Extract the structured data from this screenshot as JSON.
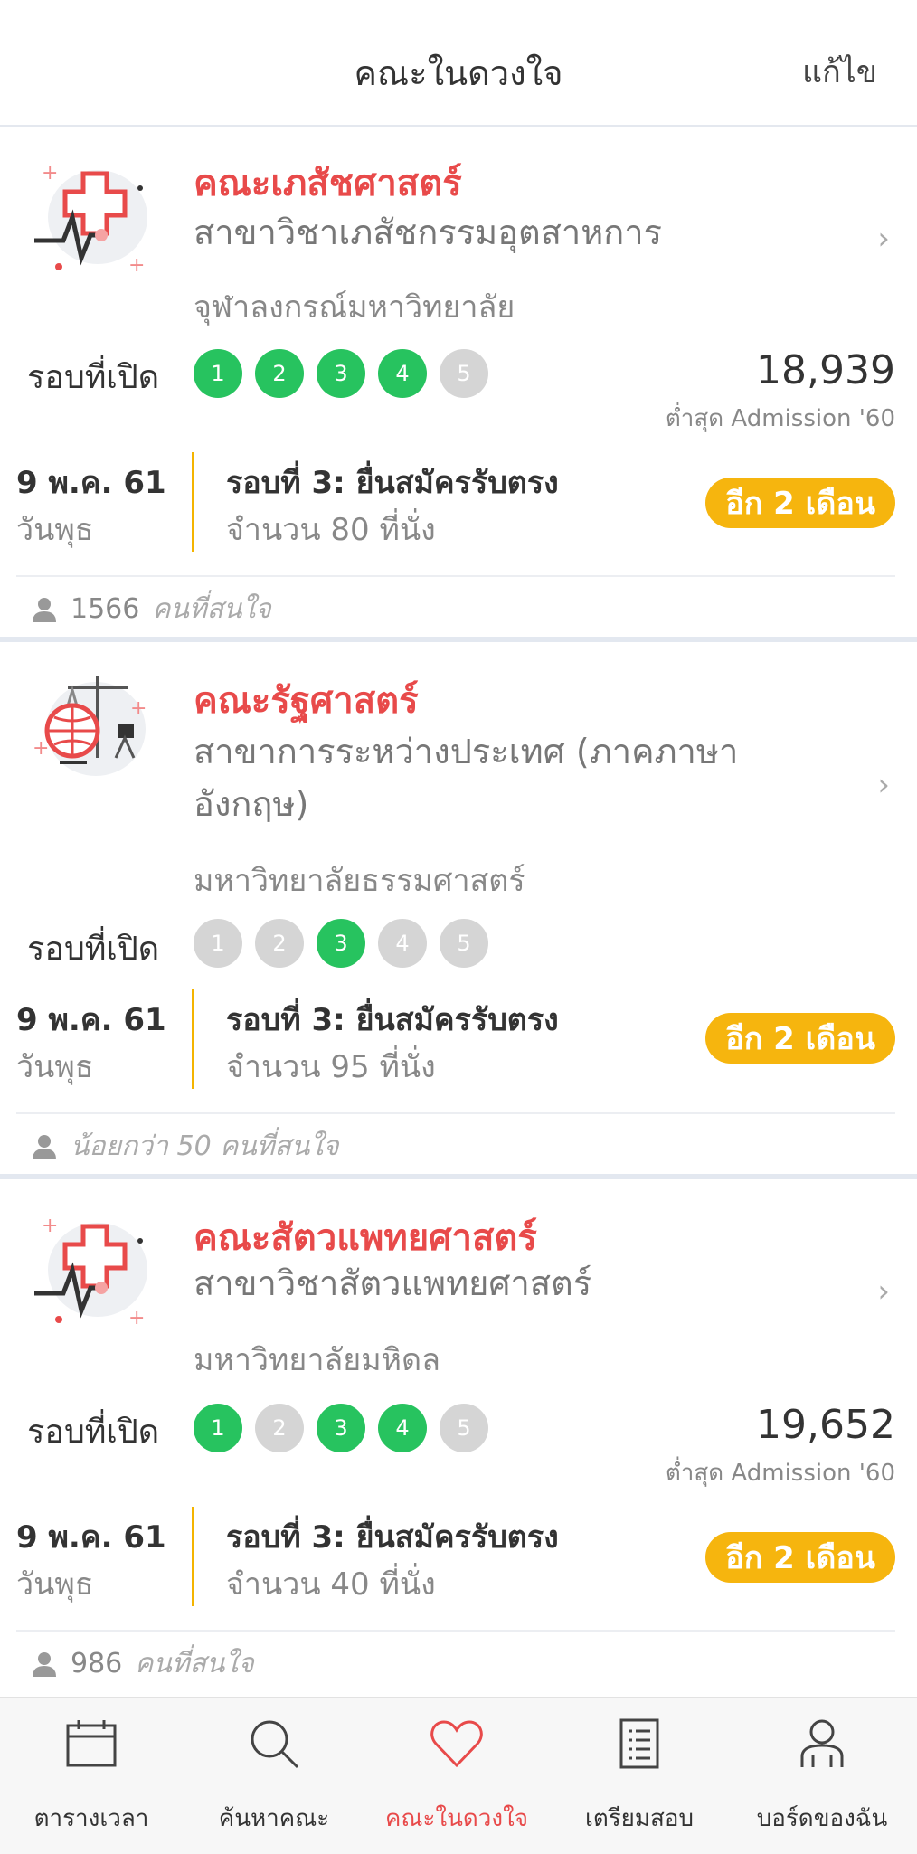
{
  "header": {
    "title": "คณะในดวงใจ",
    "edit_label": "แก้ไข"
  },
  "labels": {
    "rounds_label": "รอบที่เปิด"
  },
  "cards": [
    {
      "faculty": "คณะเภสัชศาสตร์",
      "major": "สาขาวิชาเภสัชกรรมอุตสาหการ",
      "university": "จุฬาลงกรณ์มหาวิทยาลัย",
      "rounds": [
        {
          "n": "1",
          "open": true
        },
        {
          "n": "2",
          "open": true
        },
        {
          "n": "3",
          "open": true
        },
        {
          "n": "4",
          "open": true
        },
        {
          "n": "5",
          "open": false
        }
      ],
      "score": "18,939",
      "score_note": "ต่ำสุด Admission '60",
      "date": "9 พ.ค. 61",
      "weekday": "วันพุธ",
      "round_title": "รอบที่ 3: ยื่นสมัครรับตรง",
      "seats": "จำนวน 80 ที่นั่ง",
      "badge": "อีก 2 เดือน",
      "fans_count": "1566",
      "fans_text": "คนที่สนใจ",
      "icon": "pharmacy-icon"
    },
    {
      "faculty": "คณะรัฐศาสตร์",
      "major": "สาขาการระหว่างประเทศ (ภาคภาษาอังกฤษ)",
      "university": "มหาวิทยาลัยธรรมศาสตร์",
      "rounds": [
        {
          "n": "1",
          "open": false
        },
        {
          "n": "2",
          "open": false
        },
        {
          "n": "3",
          "open": true
        },
        {
          "n": "4",
          "open": false
        },
        {
          "n": "5",
          "open": false
        }
      ],
      "date": "9 พ.ค. 61",
      "weekday": "วันพุธ",
      "round_title": "รอบที่ 3: ยื่นสมัครรับตรง",
      "seats": "จำนวน 95 ที่นั่ง",
      "badge": "อีก 2 เดือน",
      "fans_count": "",
      "fans_text": "น้อยกว่า 50 คนที่สนใจ",
      "icon": "political-science-icon"
    },
    {
      "faculty": "คณะสัตวแพทยศาสตร์",
      "major": "สาขาวิชาสัตวแพทยศาสตร์",
      "university": "มหาวิทยาลัยมหิดล",
      "rounds": [
        {
          "n": "1",
          "open": true
        },
        {
          "n": "2",
          "open": false
        },
        {
          "n": "3",
          "open": true
        },
        {
          "n": "4",
          "open": true
        },
        {
          "n": "5",
          "open": false
        }
      ],
      "score": "19,652",
      "score_note": "ต่ำสุด Admission '60",
      "date": "9 พ.ค. 61",
      "weekday": "วันพุธ",
      "round_title": "รอบที่ 3: ยื่นสมัครรับตรง",
      "seats": "จำนวน 40 ที่นั่ง",
      "badge": "อีก 2 เดือน",
      "fans_count": "986",
      "fans_text": "คนที่สนใจ",
      "icon": "veterinary-icon"
    }
  ],
  "tabs": [
    {
      "label": "ตารางเวลา",
      "icon": "calendar-icon",
      "active": false
    },
    {
      "label": "ค้นหาคณะ",
      "icon": "search-icon",
      "active": false
    },
    {
      "label": "คณะในดวงใจ",
      "icon": "heart-icon",
      "active": true
    },
    {
      "label": "เตรียมสอบ",
      "icon": "document-list-icon",
      "active": false
    },
    {
      "label": "บอร์ดของฉัน",
      "icon": "user-board-icon",
      "active": false
    }
  ],
  "colors": {
    "accent": "#e84a4a",
    "open_round": "#27c35f",
    "closed_round": "#d5d5d5",
    "badge": "#f6b50e",
    "divider": "#e3e8f0"
  }
}
